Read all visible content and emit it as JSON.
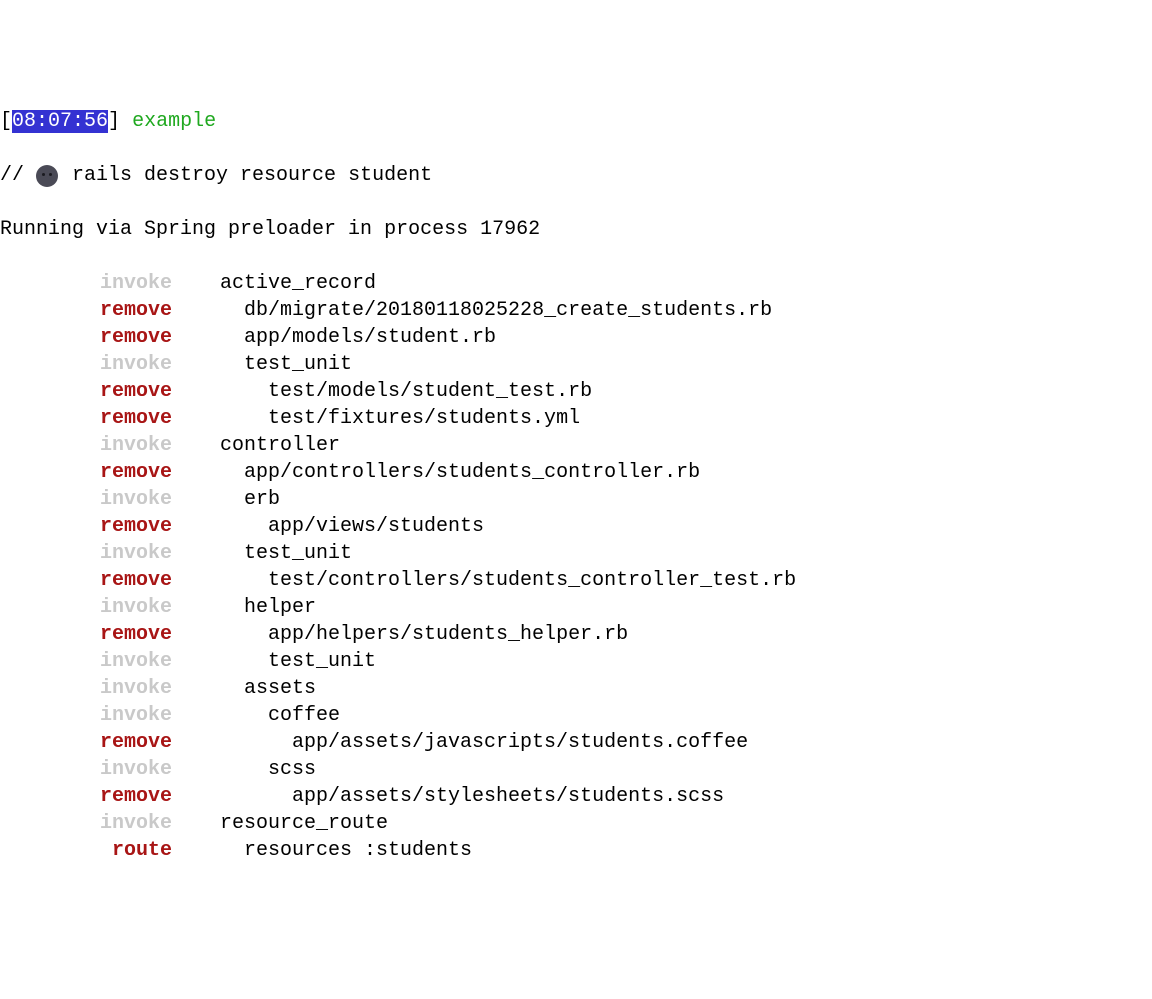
{
  "prompt": {
    "bracket_open": "[",
    "time": "08:07:56",
    "bracket_close": "]",
    "folder": "example",
    "prefix": "// ",
    "command": " rails destroy resource student"
  },
  "running": "Running via Spring preloader in process 17962",
  "lines": [
    {
      "action": "invoke",
      "cls": "invoke",
      "ind": 0,
      "path": "active_record"
    },
    {
      "action": "remove",
      "cls": "remove",
      "ind": 1,
      "path": "db/migrate/20180118025228_create_students.rb"
    },
    {
      "action": "remove",
      "cls": "remove",
      "ind": 1,
      "path": "app/models/student.rb"
    },
    {
      "action": "invoke",
      "cls": "invoke",
      "ind": 1,
      "path": "test_unit"
    },
    {
      "action": "remove",
      "cls": "remove",
      "ind": 2,
      "path": "test/models/student_test.rb"
    },
    {
      "action": "remove",
      "cls": "remove",
      "ind": 2,
      "path": "test/fixtures/students.yml"
    },
    {
      "action": "invoke",
      "cls": "invoke",
      "ind": 0,
      "path": "controller"
    },
    {
      "action": "remove",
      "cls": "remove",
      "ind": 1,
      "path": "app/controllers/students_controller.rb"
    },
    {
      "action": "invoke",
      "cls": "invoke",
      "ind": 1,
      "path": "erb"
    },
    {
      "action": "remove",
      "cls": "remove",
      "ind": 2,
      "path": "app/views/students"
    },
    {
      "action": "invoke",
      "cls": "invoke",
      "ind": 1,
      "path": "test_unit"
    },
    {
      "action": "remove",
      "cls": "remove",
      "ind": 2,
      "path": "test/controllers/students_controller_test.rb"
    },
    {
      "action": "invoke",
      "cls": "invoke",
      "ind": 1,
      "path": "helper"
    },
    {
      "action": "remove",
      "cls": "remove",
      "ind": 2,
      "path": "app/helpers/students_helper.rb"
    },
    {
      "action": "invoke",
      "cls": "invoke",
      "ind": 2,
      "path": "test_unit"
    },
    {
      "action": "invoke",
      "cls": "invoke",
      "ind": 1,
      "path": "assets"
    },
    {
      "action": "invoke",
      "cls": "invoke",
      "ind": 2,
      "path": "coffee"
    },
    {
      "action": "remove",
      "cls": "remove",
      "ind": 3,
      "path": "app/assets/javascripts/students.coffee"
    },
    {
      "action": "invoke",
      "cls": "invoke",
      "ind": 2,
      "path": "scss"
    },
    {
      "action": "remove",
      "cls": "remove",
      "ind": 3,
      "path": "app/assets/stylesheets/students.scss"
    },
    {
      "action": "invoke",
      "cls": "invoke",
      "ind": 0,
      "path": "resource_route"
    },
    {
      "action": "route",
      "cls": "route",
      "ind": 1,
      "path": "resources :students"
    }
  ]
}
